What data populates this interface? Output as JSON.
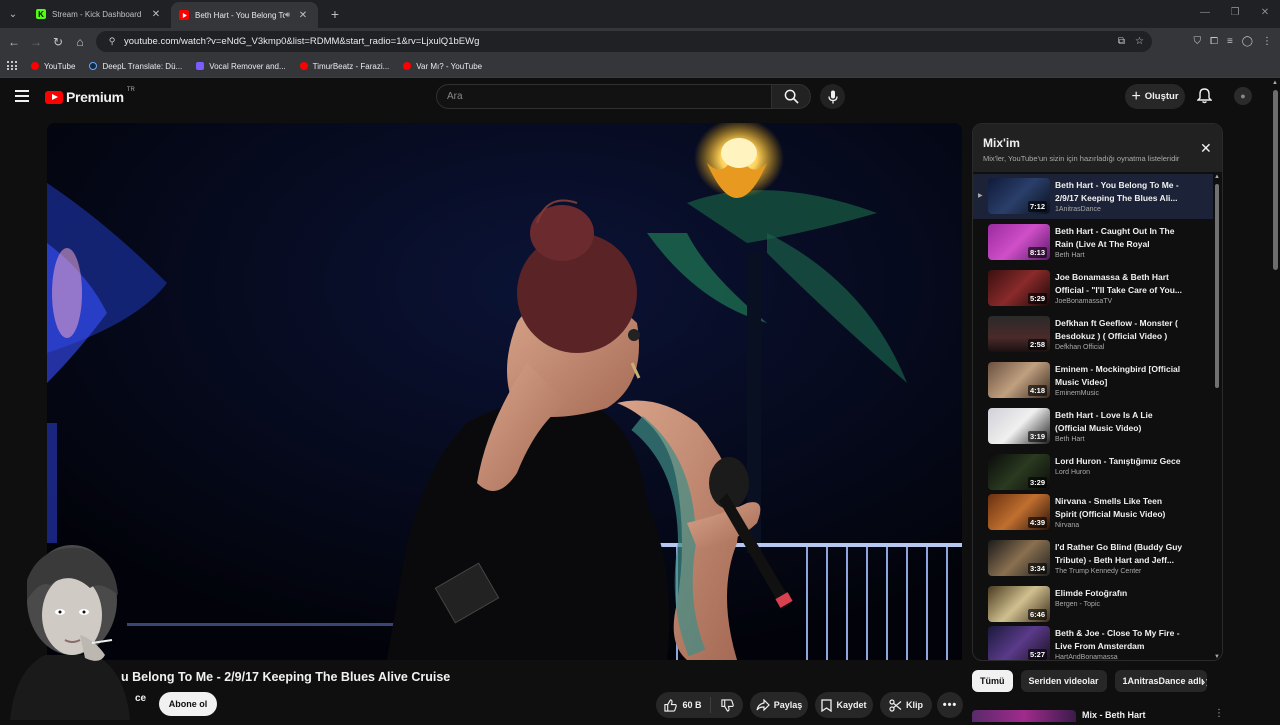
{
  "browser": {
    "tabs": [
      {
        "title": "Stream - Kick Dashboard",
        "favicon": "kick-icon"
      },
      {
        "title": "Beth Hart - You Belong To M",
        "favicon": "youtube-icon",
        "active": true
      }
    ],
    "url": "youtube.com/watch?v=eNdG_V3kmp0&list=RDMM&start_radio=1&rv=LjxulQ1bEWg",
    "bookmarks": [
      {
        "label": "YouTube",
        "color": "#ff0000"
      },
      {
        "label": "DeepL Translate: Dü...",
        "color": "#0f2b46"
      },
      {
        "label": "Vocal Remover and...",
        "color": "#7b5cff"
      },
      {
        "label": "TimurBeatz - Farazi...",
        "color": "#ff0000"
      },
      {
        "label": "Var Mı? - YouTube",
        "color": "#ff0000"
      }
    ]
  },
  "masthead": {
    "logo_text": "Premium",
    "country_code": "TR",
    "search_placeholder": "Ara",
    "create_label": "Oluştur"
  },
  "video": {
    "title_visible": "u Belong To Me - 2/9/17 Keeping The Blues Alive Cruise",
    "channel_fragment": "ce",
    "subscribe_label": "Abone ol",
    "like_count": "60 B",
    "share_label": "Paylaş",
    "save_label": "Kaydet",
    "clip_label": "Klip"
  },
  "playlist": {
    "title": "Mix'im",
    "subtitle": "Mix'ler, YouTube'un sizin için hazırladığı oynatma listeleridir",
    "items": [
      {
        "title": "Beth Hart - You Belong To Me - 2/9/17 Keeping The Blues Ali...",
        "channel": "1AnitrasDance",
        "duration": "7:12",
        "active": true
      },
      {
        "title": "Beth Hart - Caught Out In The Rain (Live At The Royal Albert...",
        "channel": "Beth Hart",
        "duration": "8:13"
      },
      {
        "title": "Joe Bonamassa & Beth Hart Official - \"I'll Take Care of You...",
        "channel": "JoeBonamassaTV",
        "duration": "5:29"
      },
      {
        "title": "Defkhan ft Geeflow - Monster ( Besdokuz ) ( Official Video )",
        "channel": "Defkhan Official",
        "duration": "2:58"
      },
      {
        "title": "Eminem - Mockingbird [Official Music Video]",
        "channel": "EminemMusic",
        "duration": "4:18"
      },
      {
        "title": "Beth Hart - Love Is A Lie (Official Music Video)",
        "channel": "Beth Hart",
        "duration": "3:19"
      },
      {
        "title": "Lord Huron - Tanıştığımız Gece",
        "channel": "Lord Huron",
        "duration": "3:29"
      },
      {
        "title": "Nirvana - Smells Like Teen Spirit (Official Music Video)",
        "channel": "Nirvana",
        "duration": "4:39"
      },
      {
        "title": "I'd Rather Go Blind (Buddy Guy Tribute) - Beth Hart and Jeff...",
        "channel": "The Trump Kennedy Center",
        "duration": "3:34"
      },
      {
        "title": "Elimde Fotoğrafın",
        "channel": "Bergen - Topic",
        "duration": "6:46"
      },
      {
        "title": "Beth & Joe - Close To My Fire - Live From Amsterdam",
        "channel": "HartAndBonamassa",
        "duration": "5:27"
      }
    ]
  },
  "chips": [
    "Tümü",
    "Seriden videolar",
    "1AnitrasDance adlı y"
  ],
  "next": {
    "title": "Mix - Beth Hart"
  }
}
